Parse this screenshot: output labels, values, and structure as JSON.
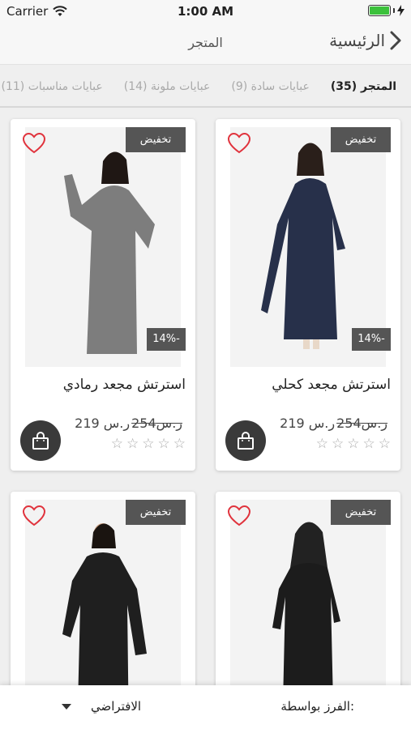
{
  "status_bar": {
    "carrier": "Carrier",
    "time": "1:00 AM"
  },
  "nav": {
    "back_label": "الرئيسية",
    "title": "المتجر"
  },
  "tabs": [
    {
      "label": "المتجر (35)",
      "active": true
    },
    {
      "label": "عبايات سادة (9)",
      "active": false
    },
    {
      "label": "عبايات ملونة (14)",
      "active": false
    },
    {
      "label": "عبايات مناسبات (11)",
      "active": false
    }
  ],
  "products": [
    {
      "name": "استرتش مجعد كحلي",
      "badge": "تخفيض",
      "discount": "14%-",
      "old_price": "254ر.س",
      "price": "219 ر.س",
      "rating": 0,
      "dress_color": "#27304a"
    },
    {
      "name": "استرتش مجعد رمادي",
      "badge": "تخفيض",
      "discount": "14%-",
      "old_price": "254ر.س",
      "price": "219 ر.س",
      "rating": 0,
      "dress_color": "#7d7d7d"
    },
    {
      "name": "",
      "badge": "تخفيض",
      "dress_color": "#1c1c1c"
    },
    {
      "name": "",
      "badge": "تخفيض",
      "dress_color": "#1f1f1f"
    }
  ],
  "sort": {
    "label": "الفرز بواسطة:",
    "value": "الافتراضي"
  },
  "colors": {
    "accent_dark": "#555555",
    "heart": "#e0323c",
    "battery": "#3cc13c"
  }
}
